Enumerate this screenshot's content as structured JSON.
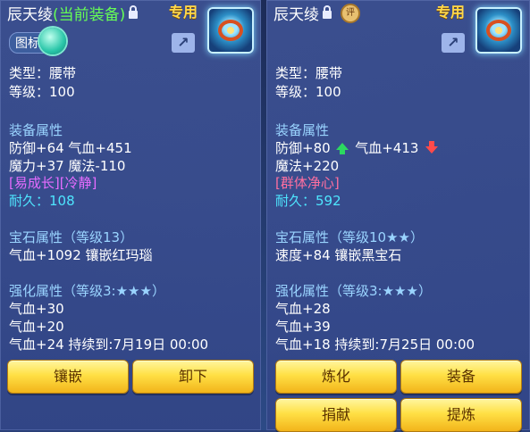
{
  "left": {
    "name": "辰天绫",
    "current_equipped": "(当前装备)",
    "exclusive": "专用",
    "toggle_label": "图标",
    "type": "类型：腰带",
    "level": "等级：100",
    "equip_attr_title": "装备属性",
    "attr_line1": "防御+64 气血+451",
    "attr_line2": "魔力+37 魔法-110",
    "special": "[易成长][冷静]",
    "durability": "耐久：108",
    "gem_title": "宝石属性（等级13）",
    "gem_line": "气血+1092 镶嵌红玛瑙",
    "enhance_title": "强化属性（等级3:★★★）",
    "enh1": "气血+30",
    "enh2": "气血+20",
    "enh3": "气血+24   持续到:7月19日 00:00",
    "buttons": [
      "镶嵌",
      "卸下"
    ]
  },
  "right": {
    "name": "辰天绫",
    "seal": "评",
    "exclusive": "专用",
    "type": "类型：腰带",
    "level": "等级：100",
    "equip_attr_title": "装备属性",
    "defense": "防御+80",
    "hp": "气血+413",
    "attr_line2": "魔法+220",
    "special": "[群体净心]",
    "durability": "耐久：592",
    "gem_title": "宝石属性（等级10★★）",
    "gem_line": "速度+84 镶嵌黑宝石",
    "enhance_title": "强化属性（等级3:★★★）",
    "enh1": "气血+28",
    "enh2": "气血+39",
    "enh3": "气血+18   持续到:7月25日 00:00",
    "buttons": [
      "炼化",
      "装备",
      "捐献",
      "提炼"
    ]
  },
  "colors": {
    "panel": "#3a4e8e",
    "section": "#9ad4ff",
    "cyan": "#4ee6ff",
    "special_left": "#e66cff",
    "special_right": "#ff6fa0",
    "exclusive": "#ffd84a",
    "current": "#66ff55",
    "button": "#ffe045"
  }
}
